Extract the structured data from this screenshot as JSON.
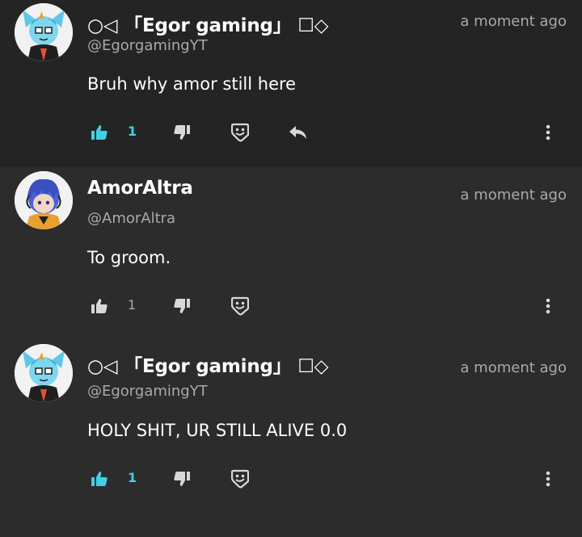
{
  "colors": {
    "accent_like": "#3fd0e8",
    "text_primary": "#ffffff",
    "text_muted": "#a9a9a9",
    "bg_highlighted": "#252424",
    "bg_default": "#2c2c2c"
  },
  "comments": [
    {
      "username": "○◁ 「Egor gaming」 ☐◇",
      "handle": "@EgorgamingYT",
      "timestamp": "a moment ago",
      "text": "Bruh why amor still here",
      "likes": "1",
      "liked": true,
      "avatar_icon": "egor-avatar-icon",
      "has_reply": true
    },
    {
      "username": "AmorAltra",
      "handle": "@AmorAltra",
      "timestamp": "a moment ago",
      "text": "To groom.",
      "likes": "1",
      "liked": false,
      "avatar_icon": "amor-avatar-icon",
      "has_reply": false
    },
    {
      "username": "○◁ 「Egor gaming」 ☐◇",
      "handle": "@EgorgamingYT",
      "timestamp": "a moment ago",
      "text": "HOLY SHIT, UR STILL ALIVE 0.0",
      "likes": "1",
      "liked": true,
      "avatar_icon": "egor-avatar-icon",
      "has_reply": false
    }
  ]
}
